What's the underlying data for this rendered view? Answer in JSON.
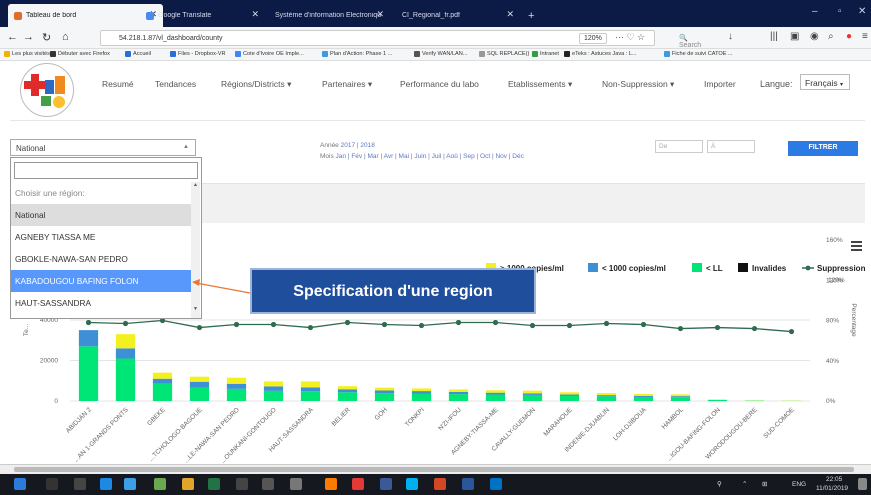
{
  "browser": {
    "tabs": [
      {
        "title": "Tableau de bord",
        "active": true
      },
      {
        "title": "Google Translate",
        "active": false
      },
      {
        "title": "Système d'information Electroniqu",
        "active": false
      },
      {
        "title": "CI_Regional_fr.pdf",
        "active": false
      }
    ],
    "new_tab": "+",
    "url": "54.218.1.87/vl_dashboard/county",
    "zoom": "120%",
    "search_placeholder": "Search",
    "bookmarks": [
      "Les plus visités",
      "Débuter avec Firefox",
      "Accueil",
      "Files - Dropbox-VR",
      "Cote d'Ivoire OE Imple...",
      "Plan d'Action: Phase 1 ...",
      "Verify WAN/LAN...",
      "SQL REPLACE()",
      "Intranet",
      "eTeks : Astuces Java : L...",
      "Fiche de suivi CATOE ..."
    ]
  },
  "nav": {
    "items": [
      "Resumé",
      "Tendances",
      "Régions/Districts",
      "Partenaires",
      "Performance du labo",
      "Etablissements",
      "Non-Suppression",
      "Importer"
    ],
    "language_label": "Langue:",
    "language_value": "Français"
  },
  "filters": {
    "region_value": "National",
    "dropdown_placeholder": "Choisir une région:",
    "regions": [
      "National",
      "AGNEBY TIASSA ME",
      "GBOKLE-NAWA-SAN PEDRO",
      "KABADOUGOU BAFING FOLON",
      "HAUT-SASSANDRA"
    ],
    "highlighted_region": "KABADOUGOU BAFING FOLON",
    "year_label": "Année",
    "years": [
      "2017",
      "2018"
    ],
    "month_label": "Mois",
    "months": [
      "Jan",
      "Fév",
      "Mar",
      "Avr",
      "Mai",
      "Juin",
      "Juil",
      "Aoû",
      "Sep",
      "Oct",
      "Nov",
      "Déc"
    ],
    "from_placeholder": "De",
    "to_placeholder": "À",
    "filter_button": "FILTRER"
  },
  "callout": "Specification d'une region",
  "chart_data": {
    "type": "bar",
    "stacked": true,
    "categories": [
      "ABIDJAN 2",
      "...AN 1-GRANDS PONTS",
      "GBEKE",
      "...TCHOLOGO-BAGOUE",
      "...LE-NAWA-SAN PEDRO",
      "...OUNKANI-GONTOUGO",
      "HAUT-SASSANDRA",
      "BELIER",
      "GOH",
      "TONKPI",
      "N'ZI-IFOU",
      "AGNEBY-TIASSA-ME",
      "CAVALLY-GUEMON",
      "MARAHOUE",
      "INDENIE-DJUABLIN",
      "LOH-DJIBOUA",
      "HAMBOL",
      "...IGOU-BAFING-FOLON",
      "WORODOUGOU-BERE",
      "SUD-COMOE"
    ],
    "series": [
      {
        "name": "< LL",
        "color": "#00e676",
        "values": [
          27000,
          21000,
          8500,
          6500,
          6000,
          5000,
          4800,
          4300,
          3900,
          3700,
          3400,
          3200,
          3000,
          2500,
          2300,
          2000,
          1900,
          500,
          200,
          100
        ]
      },
      {
        "name": "< 1000 copies/ml",
        "color": "#3d8fd6",
        "values": [
          8000,
          5000,
          2500,
          3000,
          2500,
          2200,
          1900,
          1500,
          1300,
          1200,
          1100,
          900,
          800,
          700,
          600,
          550,
          500,
          0,
          0,
          0
        ]
      },
      {
        "name": "> 1000 copies/ml",
        "color": "#f3f01f",
        "values": [
          0,
          7000,
          3000,
          2500,
          3000,
          2500,
          3000,
          1500,
          1400,
          1300,
          1200,
          1200,
          1300,
          1100,
          1000,
          900,
          900,
          300,
          100,
          100
        ]
      }
    ],
    "legend_extra": [
      {
        "name": "Invalides",
        "color": "#111111"
      },
      {
        "name": "Suppression",
        "color": "#2f6b4f"
      }
    ],
    "suppression_line": {
      "name": "Suppression",
      "values": [
        78,
        77,
        80,
        73,
        76,
        76,
        73,
        78,
        76,
        75,
        78,
        78,
        75,
        75,
        77,
        76,
        72,
        73,
        72,
        69
      ]
    },
    "ylim": [
      0,
      40000
    ],
    "yticks_left": [
      "0",
      "20000",
      "40000"
    ],
    "y2lim": [
      0,
      160
    ],
    "yticks_right": [
      "0%",
      "40%",
      "80%",
      "120%",
      "160%"
    ],
    "ylabel": "Te...",
    "y2label": "Percentage",
    "legend_position": "top-right"
  },
  "taskbar": {
    "lang": "ENG",
    "time": "22:05",
    "date": "11/01/2019"
  }
}
